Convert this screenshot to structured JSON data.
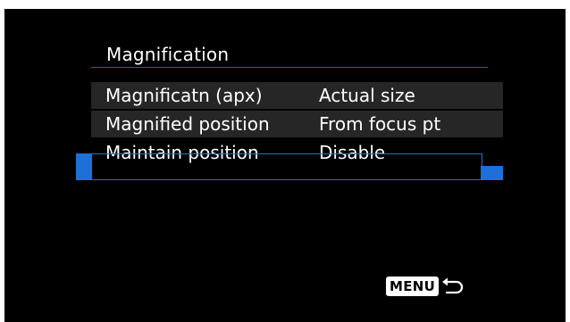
{
  "menu": {
    "title": "Magnification",
    "items": [
      {
        "label": "Magnificatn (apx)",
        "value": "Actual size",
        "selected": false
      },
      {
        "label": "Magnified position",
        "value": "From focus pt",
        "selected": false
      },
      {
        "label": "Maintain position",
        "value": "Disable",
        "selected": true
      }
    ]
  },
  "footer": {
    "menu_key_label": "MENU",
    "back_icon": "return-arrow-icon"
  },
  "colors": {
    "background": "#000000",
    "row": "#262626",
    "accent": "#1f6fd8",
    "text": "#ffffff"
  }
}
